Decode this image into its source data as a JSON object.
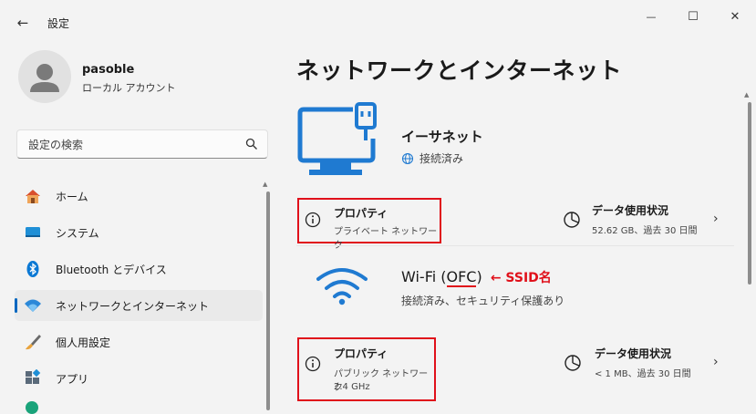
{
  "window": {
    "title": "設定",
    "back_glyph": "←",
    "minimize_glyph": "—",
    "maximize_glyph": "☐",
    "close_glyph": "✕"
  },
  "user": {
    "name": "pasoble",
    "account_type": "ローカル アカウント"
  },
  "search": {
    "placeholder": "設定の検索"
  },
  "sidebar": {
    "items": [
      {
        "label": "ホーム",
        "icon": "home-icon"
      },
      {
        "label": "システム",
        "icon": "system-icon"
      },
      {
        "label": "Bluetooth とデバイス",
        "icon": "bluetooth-icon"
      },
      {
        "label": "ネットワークとインターネット",
        "icon": "network-icon",
        "selected": true
      },
      {
        "label": "個人用設定",
        "icon": "brush-icon"
      },
      {
        "label": "アプリ",
        "icon": "apps-icon"
      }
    ]
  },
  "main": {
    "title": "ネットワークとインターネット",
    "ethernet": {
      "name": "イーサネット",
      "status": "接続済み",
      "properties": {
        "title": "プロパティ",
        "subtitle": "プライベート ネットワーク"
      },
      "data_usage": {
        "title": "データ使用状況",
        "subtitle": "52.62 GB、過去 30 日間"
      }
    },
    "wifi": {
      "name_prefix": "Wi-Fi (",
      "ssid": "OFC",
      "name_suffix": ")",
      "annotation": "← SSID名",
      "status": "接続済み、セキュリティ保護あり",
      "properties": {
        "title": "プロパティ",
        "subtitle": "パブリック ネットワーク",
        "band": "2.4 GHz"
      },
      "data_usage": {
        "title": "データ使用状況",
        "subtitle": "< 1 MB、過去 30 日間"
      }
    }
  },
  "colors": {
    "accent": "#0067c0",
    "annotation_red": "#e0101a"
  }
}
